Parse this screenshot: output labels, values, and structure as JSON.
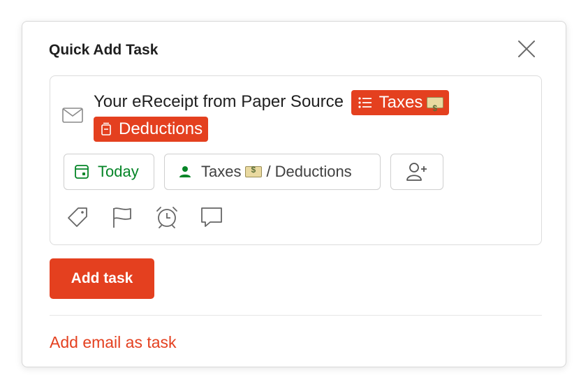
{
  "dialog": {
    "title": "Quick Add Task",
    "close_icon": "close-icon"
  },
  "editor": {
    "mail_icon": "mail-icon",
    "task_text": "Your eReceipt from Paper Source",
    "chips": [
      {
        "icon": "list-icon",
        "label": "Taxes",
        "emoji": "money-emoji"
      },
      {
        "icon": "section-icon",
        "label": "Deductions"
      }
    ],
    "pills": {
      "date": {
        "icon": "calendar-icon",
        "label": "Today"
      },
      "project": {
        "icon": "person-icon",
        "project": "Taxes",
        "emoji": "money-emoji",
        "separator": "/",
        "section": "Deductions"
      },
      "assign": {
        "icon": "add-person-icon"
      }
    },
    "actions": [
      {
        "icon": "label-icon"
      },
      {
        "icon": "flag-icon"
      },
      {
        "icon": "alarm-icon"
      },
      {
        "icon": "comment-icon"
      }
    ]
  },
  "footer": {
    "add_task_label": "Add task",
    "email_link_label": "Add email as task"
  },
  "colors": {
    "accent": "#e4401f",
    "today_green": "#058527",
    "border": "#dcdcdc",
    "icon_gray": "#666666"
  }
}
